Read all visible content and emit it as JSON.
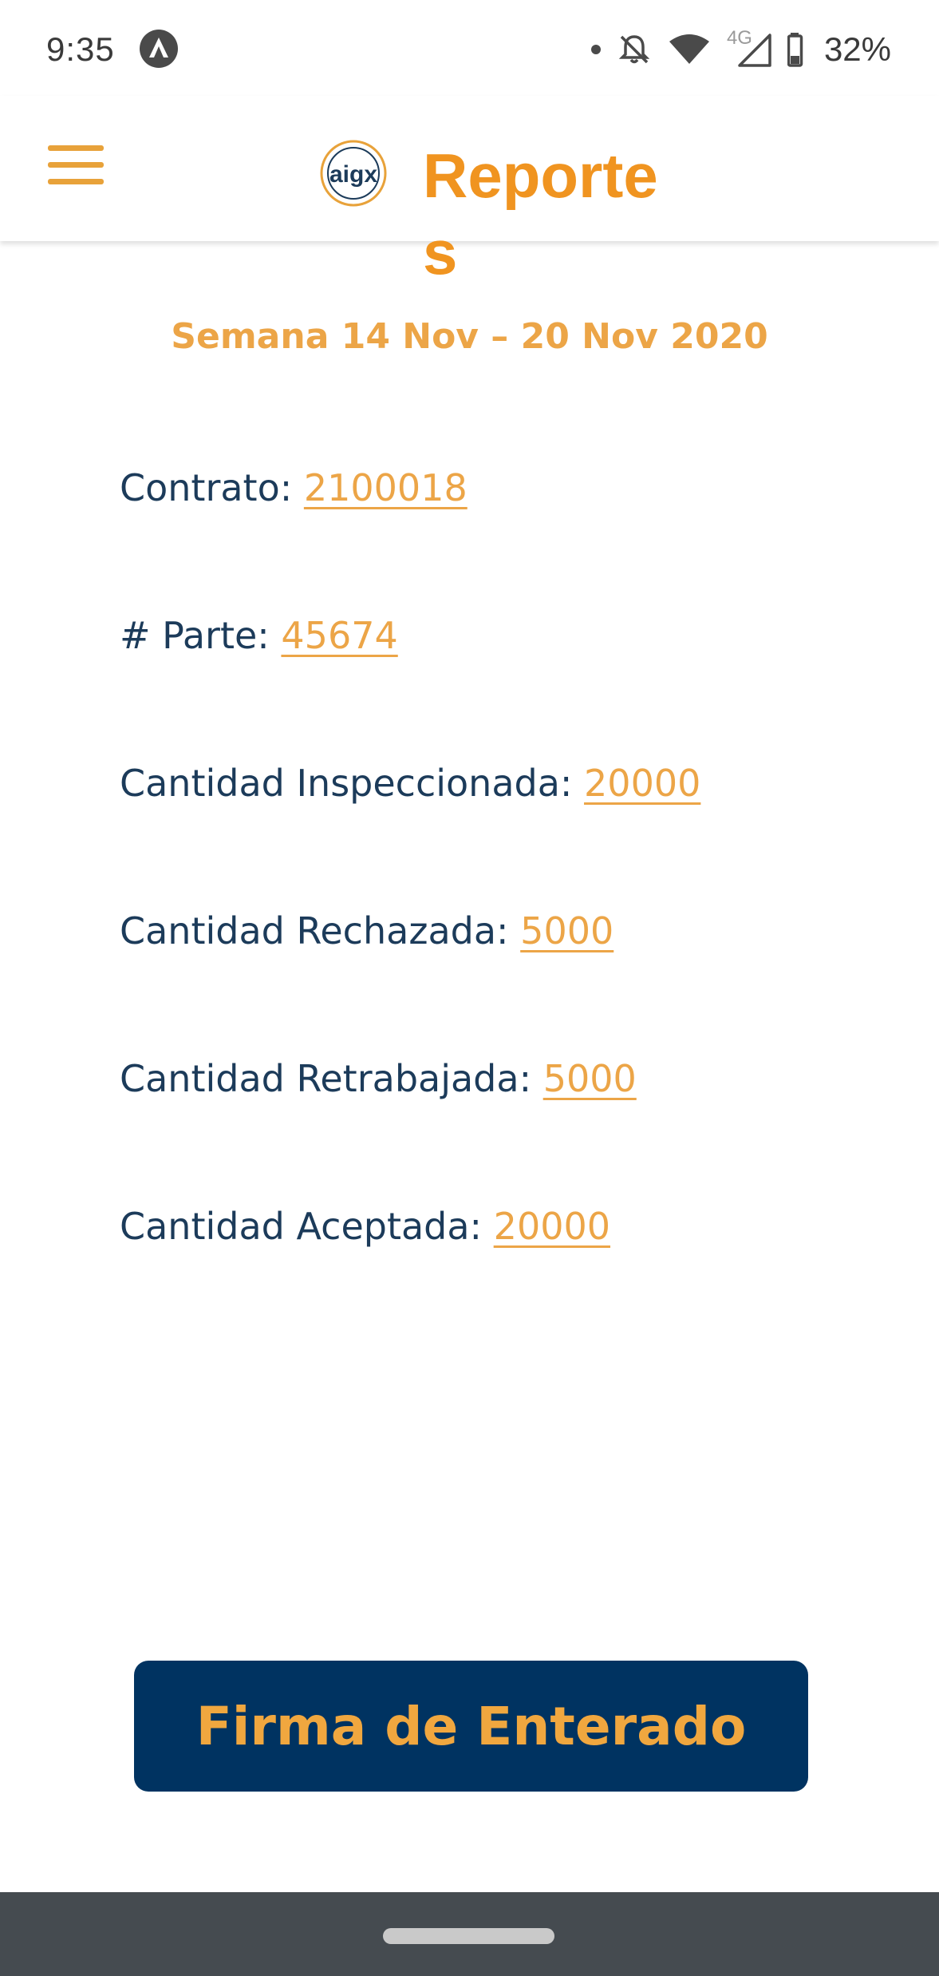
{
  "status_bar": {
    "time": "9:35",
    "app_icon": "arrow-circle-icon",
    "battery_text": "32%",
    "network_label": "4G",
    "icons": [
      "notification-dot-icon",
      "bell-off-icon",
      "wifi-icon",
      "signal-icon",
      "battery-icon"
    ]
  },
  "header": {
    "title": "Reportes",
    "logo_text": "aigx",
    "menu_icon": "hamburger-menu-icon"
  },
  "report": {
    "week": "Semana 14 Nov – 20 Nov 2020",
    "fields": [
      {
        "label": "Contrato: ",
        "value": "2100018"
      },
      {
        "label": "# Parte: ",
        "value": "45674"
      },
      {
        "label": "Cantidad Inspeccionada: ",
        "value": "20000"
      },
      {
        "label": "Cantidad Rechazada: ",
        "value": "5000"
      },
      {
        "label": "Cantidad Retrabajada: ",
        "value": "5000"
      },
      {
        "label": "Cantidad Aceptada: ",
        "value": "20000"
      }
    ]
  },
  "actions": {
    "sign_label": "Firma de Enterado"
  },
  "colors": {
    "accent": "#eca547",
    "title_orange": "#f09420",
    "navy": "#003361",
    "text": "#1c3b5a"
  }
}
